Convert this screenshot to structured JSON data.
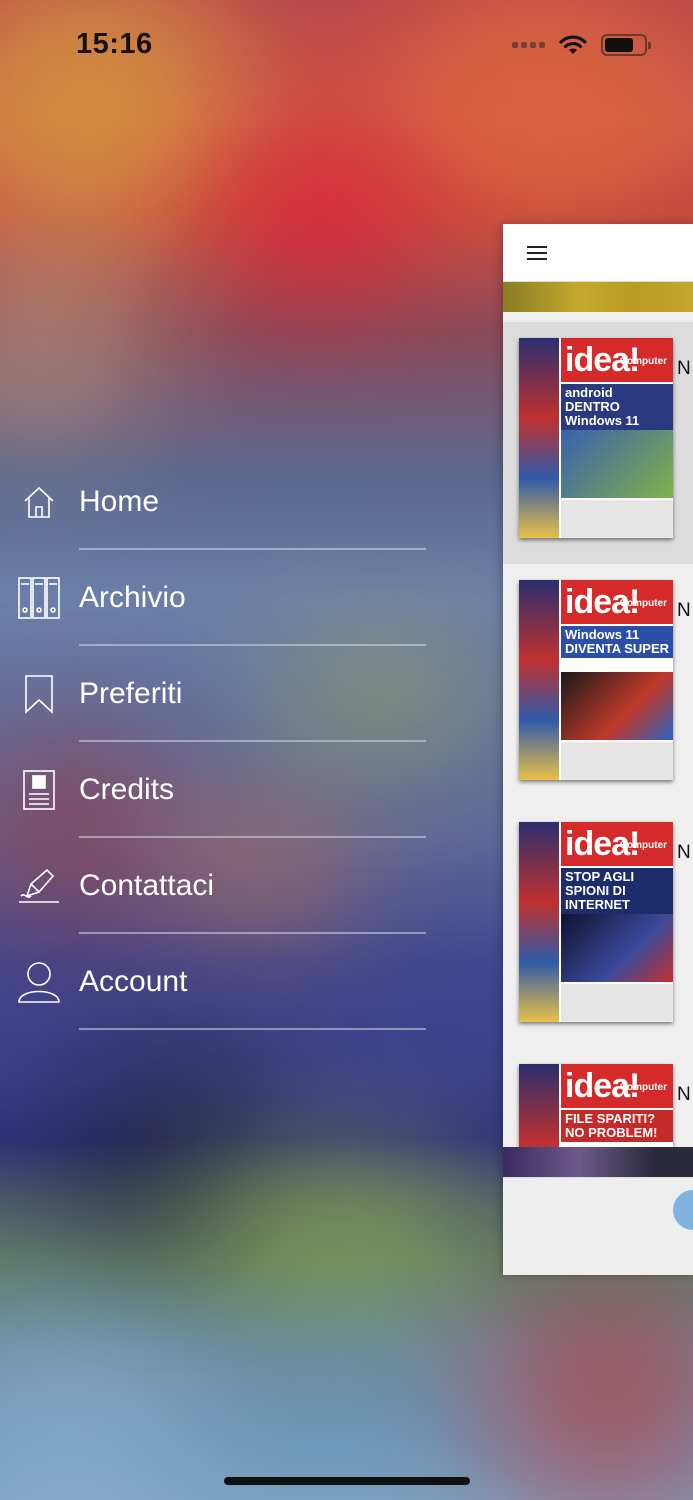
{
  "status_bar": {
    "time": "15:16"
  },
  "menu": {
    "items": [
      {
        "label": "Home",
        "icon": "home-icon"
      },
      {
        "label": "Archivio",
        "icon": "archive-icon"
      },
      {
        "label": "Preferiti",
        "icon": "bookmark-icon"
      },
      {
        "label": "Credits",
        "icon": "credits-icon"
      },
      {
        "label": "Contattaci",
        "icon": "contact-icon"
      },
      {
        "label": "Account",
        "icon": "account-icon"
      }
    ]
  },
  "panel": {
    "issues": [
      {
        "masthead": "idea!",
        "brand": "Computer",
        "headline": "android DENTRO Windows 11",
        "row_letter": "N",
        "art_color": "#3a5fb0"
      },
      {
        "masthead": "idea!",
        "brand": "Computer",
        "headline": "Windows 11 DIVENTA SUPER",
        "row_letter": "N",
        "art_color": "#2b4fa8"
      },
      {
        "masthead": "idea!",
        "brand": "Computer",
        "headline": "STOP AGLI SPIONI DI INTERNET",
        "row_letter": "N",
        "art_color": "#1d2c6b"
      },
      {
        "masthead": "idea!",
        "brand": "Computer",
        "headline": "FILE SPARITI? NO PROBLEM!",
        "row_letter": "N",
        "art_color": "#c42a2a"
      }
    ]
  }
}
